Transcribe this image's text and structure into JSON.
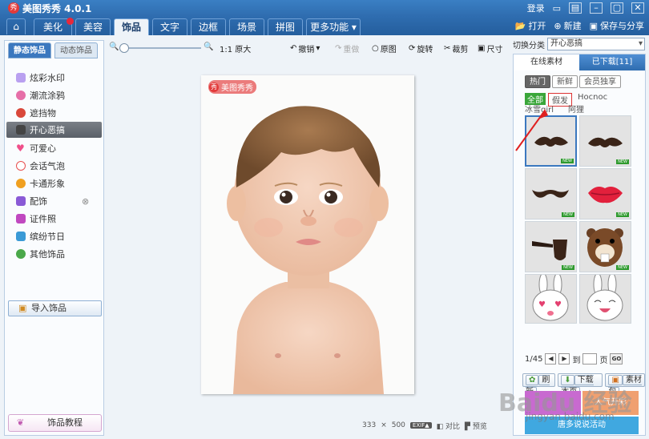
{
  "app": {
    "logo": "秀",
    "title": "美图秀秀 4.0.1"
  },
  "titlebar": {
    "login": "登录",
    "icons": [
      "chat-icon",
      "skin-icon",
      "minimize-icon",
      "maximize-icon",
      "close-icon"
    ]
  },
  "tabs": [
    {
      "label": "美化"
    },
    {
      "label": "美容"
    },
    {
      "label": "饰品"
    },
    {
      "label": "文字"
    },
    {
      "label": "边框"
    },
    {
      "label": "场景"
    },
    {
      "label": "拼图"
    },
    {
      "label": "更多功能 ▾"
    }
  ],
  "top_actions": {
    "open": "打开",
    "new": "新建",
    "save_share": "保存与分享"
  },
  "left": {
    "tabs": [
      "静态饰品",
      "动态饰品"
    ],
    "items": [
      {
        "label": "炫彩水印",
        "color": "#9b7be0"
      },
      {
        "label": "潮流涂鸦",
        "color": "#e66fa8"
      },
      {
        "label": "遮挡物",
        "color": "#d9483b"
      },
      {
        "label": "开心恶搞",
        "color": "#666666"
      },
      {
        "label": "可爱心",
        "color": "#f04f8a"
      },
      {
        "label": "会话气泡",
        "color": "#e85050"
      },
      {
        "label": "卡通形象",
        "color": "#f0a020"
      },
      {
        "label": "配饰",
        "color": "#8a5ad6"
      },
      {
        "label": "证件照",
        "color": "#c048c0"
      },
      {
        "label": "缤纷节日",
        "color": "#3a9ad6"
      },
      {
        "label": "其他饰品",
        "color": "#4aa84a"
      }
    ],
    "import_label": "导入饰品",
    "tutorial_label": "饰品教程"
  },
  "toolbar": {
    "zoom_label": "1:1 原大",
    "undo": "撤销",
    "redo": "重做",
    "original": "原图",
    "rotate": "旋转",
    "crop": "裁剪",
    "size": "尺寸"
  },
  "canvas": {
    "watermark": "美图秀秀",
    "width": "333",
    "height": "500",
    "exif": "EXIF▲",
    "compare": "对比",
    "preview": "预览"
  },
  "right": {
    "category_label": "切换分类",
    "category_value": "开心恶搞",
    "tabs": [
      "在线素材",
      "已下载[11]"
    ],
    "segments": [
      "热门",
      "新鲜",
      "会员独享"
    ],
    "filters": [
      "全部",
      "假发",
      "Hocnoc",
      "冰雪girl",
      "阿狸"
    ],
    "new_tag": "NEW",
    "items": [
      {
        "name": "mustache-1-item"
      },
      {
        "name": "mustache-2-item"
      },
      {
        "name": "mustache-3-item"
      },
      {
        "name": "lips-item"
      },
      {
        "name": "pipe-item"
      },
      {
        "name": "beaver-item"
      },
      {
        "name": "bunny-1-item"
      },
      {
        "name": "bunny-2-item"
      }
    ],
    "pager": {
      "current": "1/45",
      "to": "到",
      "page": "页",
      "go": "GO"
    },
    "buttons": [
      "刷新",
      "下载本页",
      "素材包"
    ],
    "promo": [
      "人气开彩",
      "唐多说说活动"
    ]
  },
  "watermark_site": {
    "logo": "Baidu 经验",
    "url": "jingyan.baidu.com"
  }
}
